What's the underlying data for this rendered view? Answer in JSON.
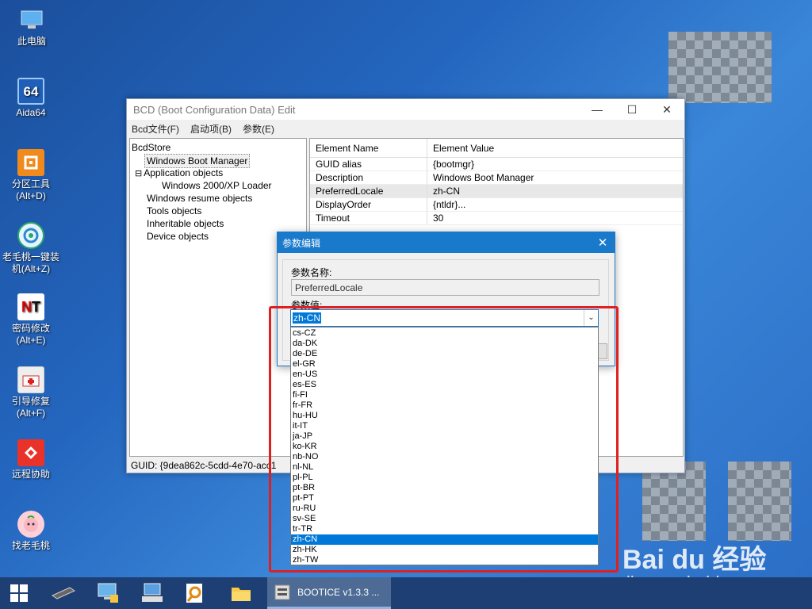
{
  "desktop": {
    "icons": [
      {
        "label": "此电脑"
      },
      {
        "label": "Aida64",
        "glyph": "64"
      },
      {
        "label": "分区工具\n(Alt+D)"
      },
      {
        "label": "老毛桃一键装\n机(Alt+Z)"
      },
      {
        "label": "密码修改\n(Alt+E)"
      },
      {
        "label": "引导修复\n(Alt+F)"
      },
      {
        "label": "远程协助"
      },
      {
        "label": "找老毛桃"
      }
    ]
  },
  "window": {
    "title": "BCD (Boot Configuration Data) Edit",
    "minimize": "—",
    "maximize": "☐",
    "close": "✕",
    "menu": [
      "Bcd文件(F)",
      "启动项(B)",
      "参数(E)"
    ],
    "tree": {
      "root": "BcdStore",
      "items": [
        "Windows Boot Manager",
        "Application objects",
        "Windows 2000/XP Loader",
        "Windows resume objects",
        "Tools objects",
        "Inheritable objects",
        "Device objects"
      ],
      "expander": "⊟"
    },
    "grid": {
      "headers": [
        "Element Name",
        "Element Value"
      ],
      "rows": [
        {
          "name": "GUID alias",
          "value": "{bootmgr}"
        },
        {
          "name": "Description",
          "value": "Windows Boot Manager"
        },
        {
          "name": "PreferredLocale",
          "value": "zh-CN"
        },
        {
          "name": "DisplayOrder",
          "value": "{ntldr}..."
        },
        {
          "name": "Timeout",
          "value": "30"
        }
      ]
    },
    "status": "GUID:   {9dea862c-5cdd-4e70-acc1"
  },
  "dialog": {
    "title": "参数编辑",
    "close": "✕",
    "name_label": "参数名称:",
    "name_value": "PreferredLocale",
    "value_label": "参数值:",
    "selected": "zh-CN",
    "arrow": "⌄",
    "options": [
      "cs-CZ",
      "da-DK",
      "de-DE",
      "el-GR",
      "en-US",
      "es-ES",
      "fi-FI",
      "fr-FR",
      "hu-HU",
      "it-IT",
      "ja-JP",
      "ko-KR",
      "nb-NO",
      "nl-NL",
      "pl-PL",
      "pt-BR",
      "pt-PT",
      "ru-RU",
      "sv-SE",
      "tr-TR",
      "zh-CN",
      "zh-HK",
      "zh-TW"
    ]
  },
  "taskbar": {
    "start_icon": "windows-start-icon",
    "active_label": "BOOTICE v1.3.3 ..."
  },
  "watermark": {
    "brand": "Bai du 经验",
    "url": "jingyan.baidu.com"
  },
  "colors": {
    "accent": "#0078d7",
    "dialog_title": "#1979ca",
    "highlight_box": "#e02020"
  }
}
